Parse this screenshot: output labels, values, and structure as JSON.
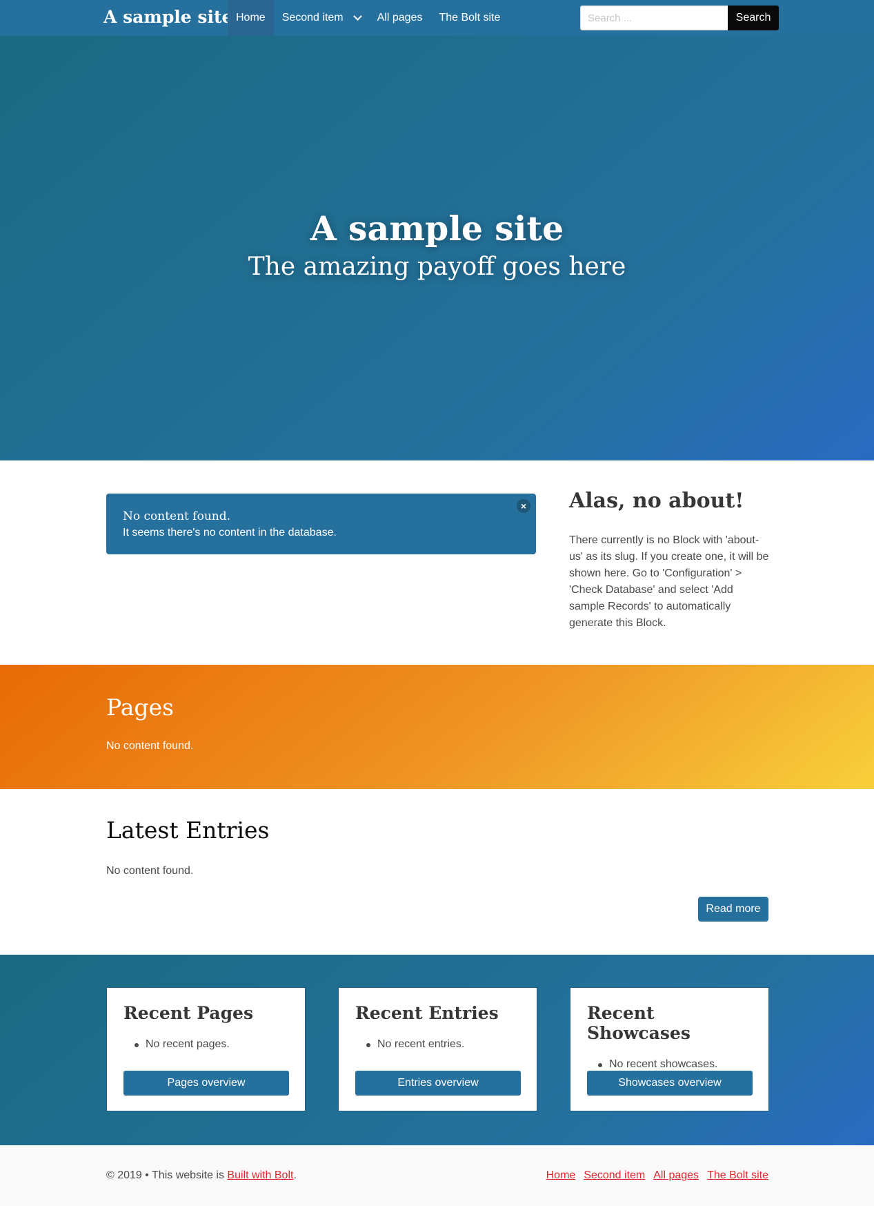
{
  "navbar": {
    "brand": "A sample site",
    "items": [
      {
        "label": "Home",
        "active": true
      },
      {
        "label": "Second item",
        "has_dropdown": true
      },
      {
        "label": "All pages"
      },
      {
        "label": "The Bolt site"
      }
    ],
    "search": {
      "placeholder": "Search ...",
      "button_label": "Search"
    }
  },
  "hero": {
    "title": "A sample site",
    "subtitle": "The amazing payoff goes here"
  },
  "notice": {
    "title": "No content found.",
    "text": "It seems there's no content in the database.",
    "close_icon": "×"
  },
  "about": {
    "title": "Alas, no about!",
    "text": "There currently is no Block with 'about-us' as its slug. If you create one, it will be shown here. Go to 'Configuration' > 'Check Database' and select 'Add sample Records' to automatically generate this Block."
  },
  "pages": {
    "title": "Pages",
    "text": "No content found."
  },
  "latest": {
    "title": "Latest Entries",
    "text": "No content found.",
    "read_more": "Read more"
  },
  "recent": [
    {
      "title": "Recent Pages",
      "item": "No recent pages.",
      "button": "Pages overview"
    },
    {
      "title": "Recent Entries",
      "item": "No recent entries.",
      "button": "Entries overview"
    },
    {
      "title": "Recent Showcases",
      "item": "No recent showcases.",
      "button": "Showcases overview"
    }
  ],
  "footer": {
    "prefix": "© 2019 • This website is ",
    "link": "Built with Bolt",
    "suffix": ".",
    "links": [
      "Home",
      "Second item",
      "All pages",
      "The Bolt site"
    ]
  },
  "colors": {
    "primary": "#26709e",
    "accent_orange": "#ef9425",
    "link_red": "#e0282e"
  }
}
